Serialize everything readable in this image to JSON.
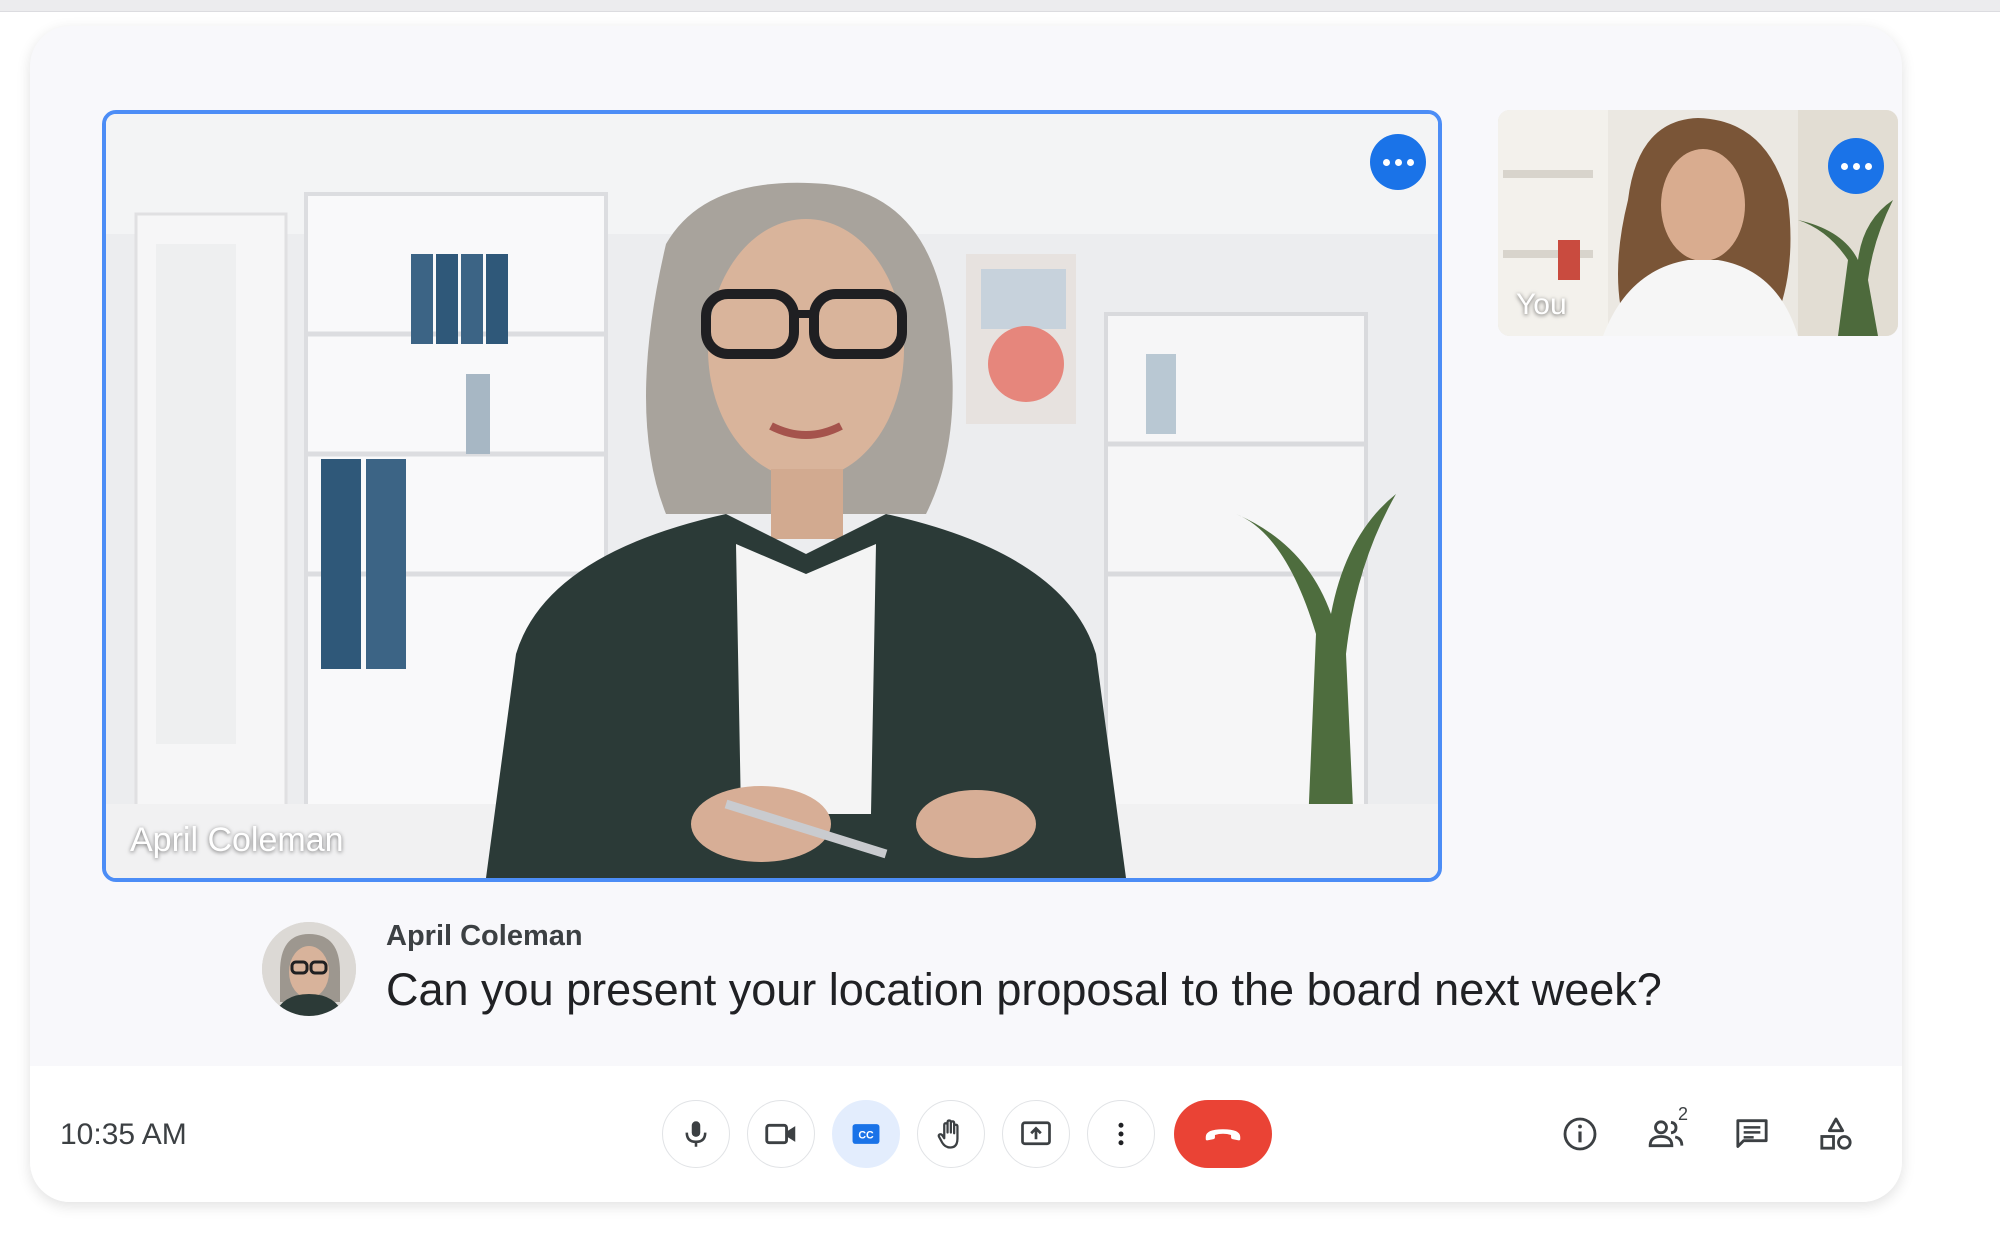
{
  "main_video": {
    "participant_name": "April Coleman",
    "more_options_icon": "more-horiz-icon"
  },
  "self_video": {
    "label": "You",
    "more_options_icon": "more-horiz-icon"
  },
  "caption": {
    "speaker": "April Coleman",
    "text": "Can you present your location proposal to the board next week?"
  },
  "control_bar": {
    "time": "10:35 AM",
    "controls": [
      {
        "icon": "mic-icon",
        "state": "on"
      },
      {
        "icon": "camera-icon",
        "state": "on"
      },
      {
        "icon": "closed-captions-icon",
        "state": "active"
      },
      {
        "icon": "raise-hand-icon",
        "state": "off"
      },
      {
        "icon": "present-screen-icon",
        "state": "off"
      },
      {
        "icon": "more-vert-icon",
        "state": "off"
      },
      {
        "icon": "end-call-icon",
        "state": "off"
      }
    ],
    "side_actions": {
      "info_icon": "info-icon",
      "people_icon": "people-icon",
      "people_count": "2",
      "chat_icon": "chat-icon",
      "activities_icon": "activities-icon"
    }
  },
  "colors": {
    "accent": "#1a73e8",
    "tile_border": "#4c8df6",
    "end_call": "#ea4335",
    "cc_active_bg": "#e3edfd"
  }
}
